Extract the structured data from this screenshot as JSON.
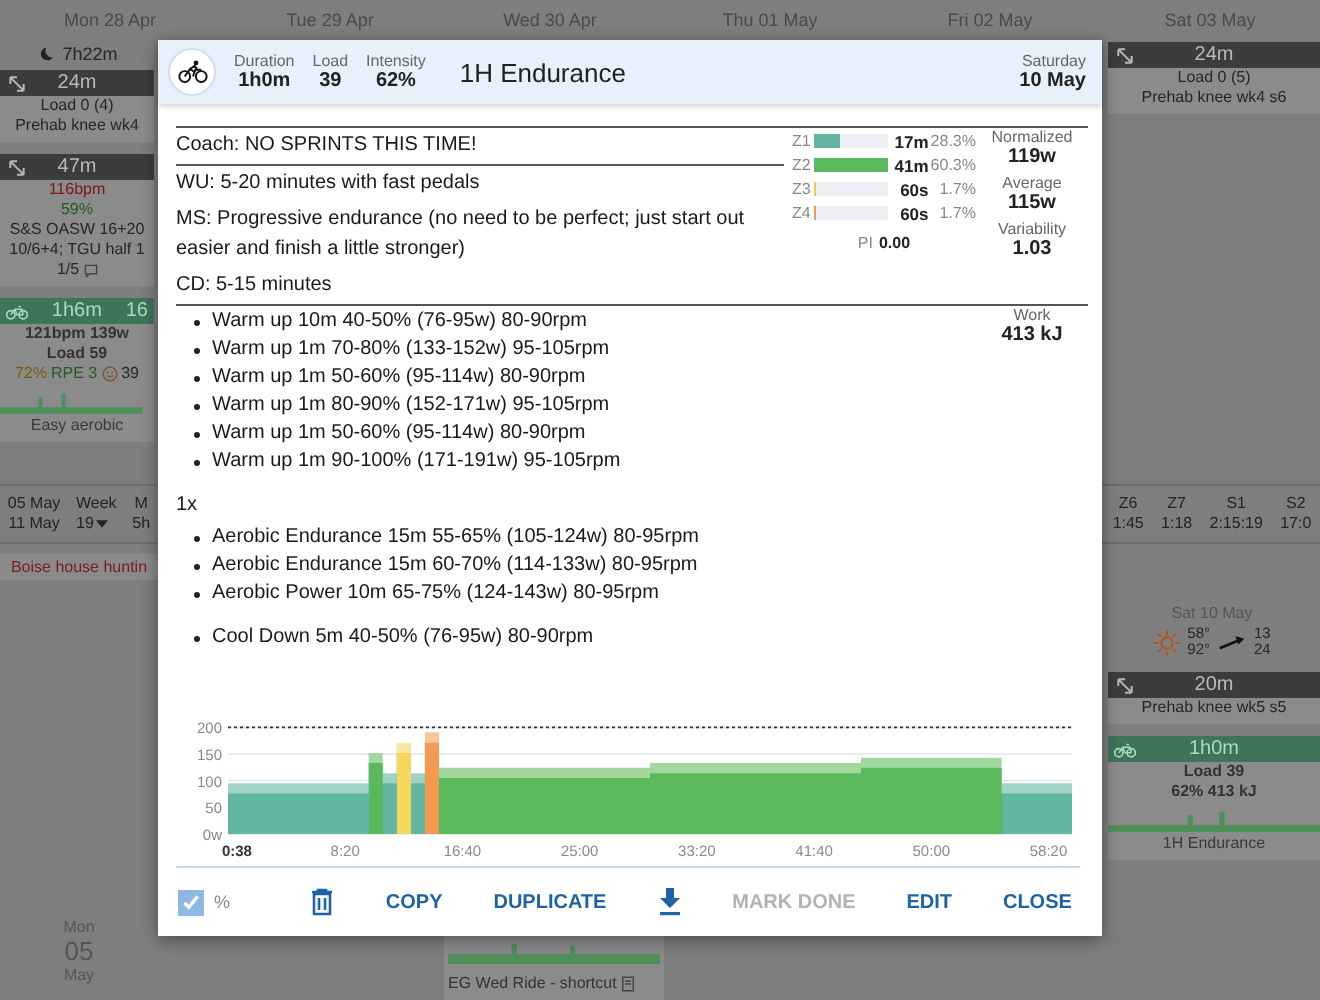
{
  "calendar": {
    "day_headers": [
      "Mon 28 Apr",
      "Tue 29 Apr",
      "Wed 30 Apr",
      "Thu 01 May",
      "Fri 02 May",
      "Sat 03 May"
    ],
    "sleep": "7h22m",
    "left_cards": [
      {
        "kind": "strength",
        "duration": "24m",
        "lines": [
          {
            "kind": "text",
            "text": "Load 0 (4)"
          },
          {
            "kind": "text",
            "text": "Prehab knee wk4"
          }
        ]
      },
      {
        "kind": "strength",
        "duration": "47m",
        "lines": [
          {
            "kind": "hr",
            "text": "116bpm"
          },
          {
            "kind": "good",
            "text": "59%"
          },
          {
            "kind": "text",
            "text": "S&S OASW 16+20"
          },
          {
            "kind": "text",
            "text": "10/6+4; TGU half 1"
          },
          {
            "kind": "comments",
            "text": "1/5"
          }
        ]
      },
      {
        "kind": "ride",
        "duration": "1h6m",
        "badge": "16",
        "lines": [
          {
            "kind": "bold",
            "text": "121bpm 139w"
          },
          {
            "kind": "bold",
            "text": "Load 59"
          },
          {
            "kind": "rpe",
            "parts": [
              "72%",
              "RPE 3",
              "39"
            ]
          }
        ],
        "title": "Easy aerobic"
      }
    ],
    "week": {
      "start": "05 May",
      "end": "11 May",
      "label": "Week",
      "number": "19",
      "column_3_label": "M",
      "column_3_value": "5h"
    },
    "note": "Boise house huntin",
    "next_day": {
      "weekday": "Mon",
      "day": "05",
      "month": "May"
    },
    "right_cards": [
      {
        "kind": "strength",
        "duration": "24m",
        "lines": [
          {
            "kind": "text",
            "text": "Load 0 (5)"
          },
          {
            "kind": "text",
            "text": "Prehab knee wk4 s6"
          }
        ]
      }
    ],
    "week_totals": [
      {
        "label": "Z6",
        "value": "1:45"
      },
      {
        "label": "Z7",
        "value": "1:18"
      },
      {
        "label": "S1",
        "value": "2:15:19"
      },
      {
        "label": "S2",
        "value": "17:0"
      }
    ],
    "sat_10": {
      "header": "Sat 10 May",
      "temp_high": "58°",
      "temp_low": "92°",
      "wind": "13",
      "gust": "24"
    },
    "sat_cards": [
      {
        "kind": "strength",
        "duration": "20m",
        "lines": [
          {
            "kind": "text",
            "text": "Prehab knee wk5 s5"
          }
        ]
      },
      {
        "kind": "ride",
        "duration": "1h0m",
        "lines": [
          {
            "kind": "bold",
            "text": "Load 39"
          },
          {
            "kind": "bold",
            "text": "62% 413 kJ"
          }
        ],
        "title": "1H Endurance"
      }
    ],
    "wed_item": {
      "title": "EG Wed Ride - shortcut"
    }
  },
  "workout": {
    "kind": "ride",
    "stats": [
      {
        "label": "Duration",
        "value": "1h0m"
      },
      {
        "label": "Load",
        "value": "39"
      },
      {
        "label": "Intensity",
        "value": "62%"
      }
    ],
    "title": "1H Endurance",
    "weekday": "Saturday",
    "date": "10 May",
    "notes": [
      "Coach: NO SPRINTS THIS TIME!",
      "WU: 5-20 minutes with fast pedals",
      "MS: Progressive endurance (no need to be perfect; just start out easier and finish a little stronger)",
      "CD: 5-15 minutes"
    ],
    "zones": [
      {
        "label": "Z1",
        "level": 0.35,
        "color": "#5fb5a0",
        "time": "17m",
        "percent": "28.3%"
      },
      {
        "label": "Z2",
        "level": 1.0,
        "color": "#5cb85c",
        "time": "41m",
        "percent": "60.3%"
      },
      {
        "label": "Z3",
        "level": 0.03,
        "color": "#f2c94c",
        "time": "60s",
        "percent": "1.7%"
      },
      {
        "label": "Z4",
        "level": 0.03,
        "color": "#f29a50",
        "time": "60s",
        "percent": "1.7%"
      }
    ],
    "pi": {
      "label": "PI",
      "value": "0.00"
    },
    "metrics": [
      {
        "label": "Normalized",
        "value": "119w"
      },
      {
        "label": "Average",
        "value": "115w"
      },
      {
        "label": "Variability",
        "value": "1.03"
      },
      {
        "label": "Work",
        "value": "413 kJ"
      }
    ],
    "step_groups": [
      {
        "steps": [
          "Warm up 10m 40-50% (76-95w) 80-90rpm",
          "Warm up 1m 70-80% (133-152w) 95-105rpm",
          "Warm up 1m 50-60% (95-114w) 80-90rpm",
          "Warm up 1m 80-90% (152-171w) 95-105rpm",
          "Warm up 1m 50-60% (95-114w) 80-90rpm",
          "Warm up 1m 90-100% (171-191w) 95-105rpm"
        ]
      },
      {
        "repeat": "1x",
        "steps": [
          "Aerobic Endurance 15m 55-65% (105-124w) 80-95rpm",
          "Aerobic Endurance 15m 60-70% (114-133w) 80-95rpm",
          "Aerobic Power 10m 65-75% (124-143w) 80-95rpm"
        ]
      },
      {
        "steps": [
          "Cool Down 5m 40-50% (76-95w) 80-90rpm"
        ]
      }
    ],
    "chart": {
      "chart_data": {
        "type": "area",
        "x": [
          0,
          600,
          600,
          660,
          660,
          720,
          720,
          780,
          780,
          840,
          840,
          900,
          900,
          1800,
          1800,
          2700,
          2700,
          3300,
          3300,
          3600
        ],
        "series": [
          {
            "values": [
              76,
              76,
              133,
              133,
              95,
              95,
              152,
              152,
              95,
              95,
              171,
              171,
              105,
              105,
              114,
              114,
              124,
              124,
              76,
              76
            ]
          },
          {
            "values": [
              95,
              95,
              152,
              152,
              114,
              114,
              171,
              171,
              114,
              114,
              191,
              191,
              124,
              124,
              133,
              133,
              143,
              143,
              95,
              95
            ]
          }
        ],
        "xlim": [
          0,
          3600
        ],
        "ylim": [
          0,
          210
        ],
        "xticks": [
          {
            "value": 38,
            "label": "0:38"
          },
          {
            "value": 500,
            "label": "8:20"
          },
          {
            "value": 1000,
            "label": "16:40"
          },
          {
            "value": 1500,
            "label": "25:00"
          },
          {
            "value": 2000,
            "label": "33:20"
          },
          {
            "value": 2500,
            "label": "41:40"
          },
          {
            "value": 3000,
            "label": "50:00"
          },
          {
            "value": 3500,
            "label": "58:20"
          }
        ],
        "yticks": [
          {
            "value": 0,
            "label": "0w"
          },
          50,
          100,
          150,
          200
        ],
        "grid": true,
        "ref_lines": [
          {
            "axis": "y",
            "value": 200
          }
        ]
      }
    },
    "footer": {
      "percent": {
        "label": "%",
        "checked": true
      },
      "buttons": [
        {
          "kind": "delete"
        },
        {
          "kind": "text",
          "label": "COPY",
          "disabled": false
        },
        {
          "kind": "text",
          "label": "DUPLICATE",
          "disabled": false
        },
        {
          "kind": "download"
        },
        {
          "kind": "text",
          "label": "MARK DONE",
          "disabled": true
        },
        {
          "kind": "text",
          "label": "EDIT",
          "disabled": false
        },
        {
          "kind": "text",
          "label": "CLOSE",
          "disabled": false
        }
      ]
    }
  }
}
